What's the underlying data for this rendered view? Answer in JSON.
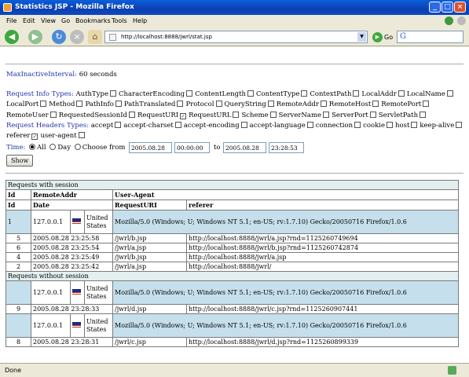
{
  "window": {
    "title": "Statistics JSP - Mozilla Firefox"
  },
  "menu": [
    "File",
    "Edit",
    "View",
    "Go",
    "Bookmarks",
    "Tools",
    "Help"
  ],
  "nav": {
    "url": "http://localhost:8888/jwrl/stat.jsp",
    "go_label": "Go",
    "search_glyph": "G"
  },
  "page": {
    "max_inactive_label": "MaxInactiveInterval:",
    "max_inactive_value": "60 seconds",
    "request_info_label": "Request Info Types:",
    "request_info_items": [
      {
        "label": "AuthType",
        "checked": false
      },
      {
        "label": "CharacterEncoding",
        "checked": false
      },
      {
        "label": "ContentLength",
        "checked": false
      },
      {
        "label": "ContentType",
        "checked": false
      },
      {
        "label": "ContextPath",
        "checked": false
      },
      {
        "label": "LocalAddr",
        "checked": false
      },
      {
        "label": "LocalName",
        "checked": false
      },
      {
        "label": "LocalPort",
        "checked": false
      },
      {
        "label": "Method",
        "checked": false
      },
      {
        "label": "PathInfo",
        "checked": false
      },
      {
        "label": "PathTranslated",
        "checked": false
      },
      {
        "label": "Protocol",
        "checked": false
      },
      {
        "label": "QueryString",
        "checked": false
      },
      {
        "label": "RemoteAddr",
        "checked": false
      },
      {
        "label": "RemoteHost",
        "checked": false
      },
      {
        "label": "RemotePort",
        "checked": false
      },
      {
        "label": "RemoteUser",
        "checked": false
      },
      {
        "label": "RequestedSessionId",
        "checked": false
      },
      {
        "label": "RequestURI",
        "checked": true
      },
      {
        "label": "RequestURL",
        "checked": false
      },
      {
        "label": "Scheme",
        "checked": false
      },
      {
        "label": "ServerName",
        "checked": false
      },
      {
        "label": "ServerPort",
        "checked": false
      },
      {
        "label": "ServletPath",
        "checked": false
      }
    ],
    "headers_label": "Request Headers Types:",
    "header_items": [
      {
        "label": "accept",
        "checked": false
      },
      {
        "label": "accept-charset",
        "checked": false
      },
      {
        "label": "accept-encoding",
        "checked": false
      },
      {
        "label": "accept-language",
        "checked": false
      },
      {
        "label": "connection",
        "checked": false
      },
      {
        "label": "cookie",
        "checked": false
      },
      {
        "label": "host",
        "checked": false
      },
      {
        "label": "keep-alive",
        "checked": false
      },
      {
        "label": "referer",
        "checked": true
      },
      {
        "label": "user-agent",
        "checked": false
      }
    ],
    "time_label": "Time:",
    "time_all": "All",
    "time_day": "Day",
    "time_choose": "Choose from",
    "time_to": "to",
    "from_date": "2005.08.28",
    "from_time": "00:00:00",
    "to_date": "2005.08.28",
    "to_time": "23:28:53",
    "show_label": "Show"
  },
  "table": {
    "with_session": "Requests with session",
    "without_session": "Requests without session",
    "h_id": "Id",
    "h_remote": "RemoteAddr",
    "h_agent": "User-Agent",
    "h_date": "Date",
    "h_uri": "RequestURI",
    "h_referer": "referer",
    "country": "United States",
    "agent": "Mozilla/5.0 (Windows; U; Windows NT 5.1; en-US; rv:1.7.10) Gecko/20050716 Firefox/1.0.6",
    "groups": [
      {
        "section": "with",
        "session": {
          "id": "1",
          "addr": "127.0.0.1"
        },
        "rows": [
          {
            "id": "5",
            "date": "2005.08.28 23:25:58",
            "uri": "/jwrl/b.jsp",
            "ref": "http://localhost:8888/jwrl/a.jsp?rnd=1125260749694"
          },
          {
            "id": "6",
            "date": "2005.08.28 23:25:54",
            "uri": "/jwrl/a.jsp",
            "ref": "http://localhost:8888/jwrl/b.jsp?rnd=1125260742874"
          },
          {
            "id": "4",
            "date": "2005.08.28 23:25:49",
            "uri": "/jwrl/b.jsp",
            "ref": "http://localhost:8888/jwrl/a.jsp"
          },
          {
            "id": "2",
            "date": "2005.08.28 23:25:42",
            "uri": "/jwrl/a.jsp",
            "ref": "http://localhost:8888/jwrl/"
          }
        ]
      },
      {
        "section": "without",
        "session": {
          "id": "",
          "addr": "127.0.0.1"
        },
        "rows": [
          {
            "id": "9",
            "date": "2005.08.28 23:28:33",
            "uri": "/jwrl/d.jsp",
            "ref": "http://localhost:8888/jwrl/c.jsp?rnd=1125260907441"
          }
        ]
      },
      {
        "section": "",
        "session": {
          "id": "",
          "addr": "127.0.0.1"
        },
        "rows": [
          {
            "id": "8",
            "date": "2005.08.28 23:28:31",
            "uri": "/jwrl/c.jsp",
            "ref": "http://localhost:8888/jwrl/d.jsp?rnd=1125260899339"
          }
        ]
      }
    ]
  },
  "status": {
    "text": "Done"
  },
  "colors": {
    "link": "#2233aa",
    "section_bg": "#e3efef",
    "agent_bg": "#c5e0ec",
    "titlebar": "#0d3fb0"
  }
}
